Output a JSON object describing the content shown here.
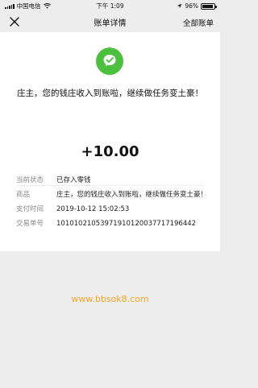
{
  "status_bar": {
    "carrier": "中国电信",
    "time": "下午 1:09",
    "battery_percent": "96%",
    "battery_level": 0.96
  },
  "nav": {
    "title": "账单详情",
    "right_action": "全部账单"
  },
  "transaction": {
    "headline": "庄主，您的钱庄收入到账啦，继续做任务变土豪！",
    "amount": "+10.00",
    "icon_color": "#4cbf3f"
  },
  "details": [
    {
      "label": "当前状态",
      "value": "已存入零钱"
    },
    {
      "label": "商品",
      "value": "庄主，您的钱庄收入到账啦，继续做任务变土豪！"
    },
    {
      "label": "支付时间",
      "value": "2019-10-12 15:02:53"
    },
    {
      "label": "交易单号",
      "value": "1010102105397191012003771719644​2"
    }
  ],
  "watermark": "www.bbsok8.com",
  "colors": {
    "accent_green": "#4cbf3f",
    "watermark_orange": "#f5a623"
  }
}
